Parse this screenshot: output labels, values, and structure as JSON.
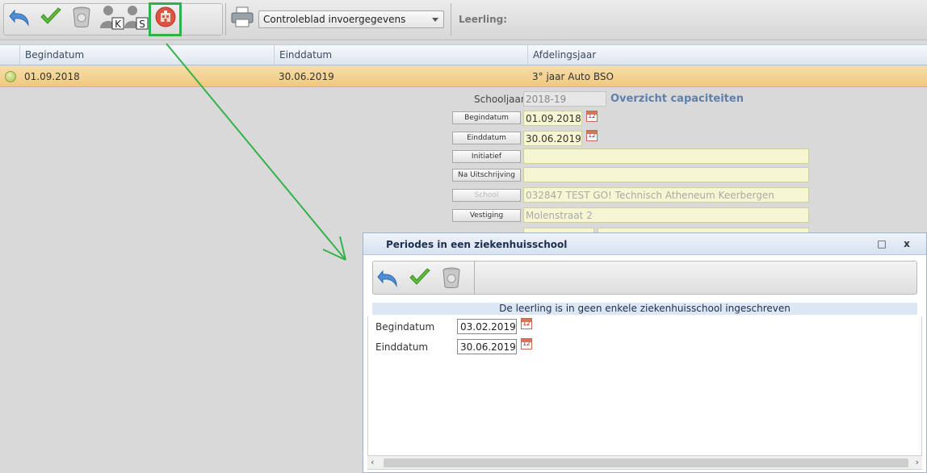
{
  "toolbar": {
    "buttons": [
      {
        "name": "undo",
        "icon": "undo-arrow-icon"
      },
      {
        "name": "save",
        "icon": "checkmark-icon"
      },
      {
        "name": "delete",
        "icon": "trash-bin-icon"
      },
      {
        "name": "person-k",
        "icon": "person-k-icon",
        "letter": "K"
      },
      {
        "name": "person-s",
        "icon": "person-s-icon",
        "letter": "S"
      },
      {
        "name": "hospital",
        "icon": "hospital-icon"
      }
    ],
    "print_icon": "printer-icon",
    "report_select": "Controleblad invoergegevens",
    "leerling_label": "Leerling:"
  },
  "grid": {
    "columns": [
      "Begindatum",
      "Einddatum",
      "Afdelingsjaar"
    ],
    "rows": [
      {
        "begindatum": "01.09.2018",
        "einddatum": "30.06.2019",
        "afdelingsjaar": "3° jaar Auto BSO"
      }
    ]
  },
  "form": {
    "schooljaar_label": "Schooljaar",
    "schooljaar_value": "2018-19",
    "overzicht_link": "Overzicht capaciteiten",
    "begindatum_label": "Begindatum",
    "begindatum_value": "01.09.2018",
    "einddatum_label": "Einddatum",
    "einddatum_value": "30.06.2019",
    "initiatief_label": "Initiatief",
    "initiatief_value": "",
    "na_uitschrijving_label": "Na Uitschrijving",
    "na_uitschrijving_value": "",
    "school_label": "School",
    "school_value": "032847 TEST GO! Technisch Atheneum Keerbergen",
    "vestiging_label": "Vestiging",
    "vestiging_value": "Molenstraat 2",
    "calendar_day": "12"
  },
  "dialog": {
    "title": "Periodes in een ziekenhuisschool",
    "maximize_glyph": "□",
    "close_glyph": "x",
    "message": "De leerling is in geen enkele ziekenhuisschool ingeschreven",
    "begindatum_label": "Begindatum",
    "begindatum_value": "03.02.2019",
    "einddatum_label": "Einddatum",
    "einddatum_value": "30.06.2019",
    "calendar_day": "12"
  },
  "colors": {
    "highlight": "#2fb24a",
    "selected_row": "#f0c97f",
    "field_bg": "#f6f6d2",
    "accent_text": "#5f7fa8"
  }
}
